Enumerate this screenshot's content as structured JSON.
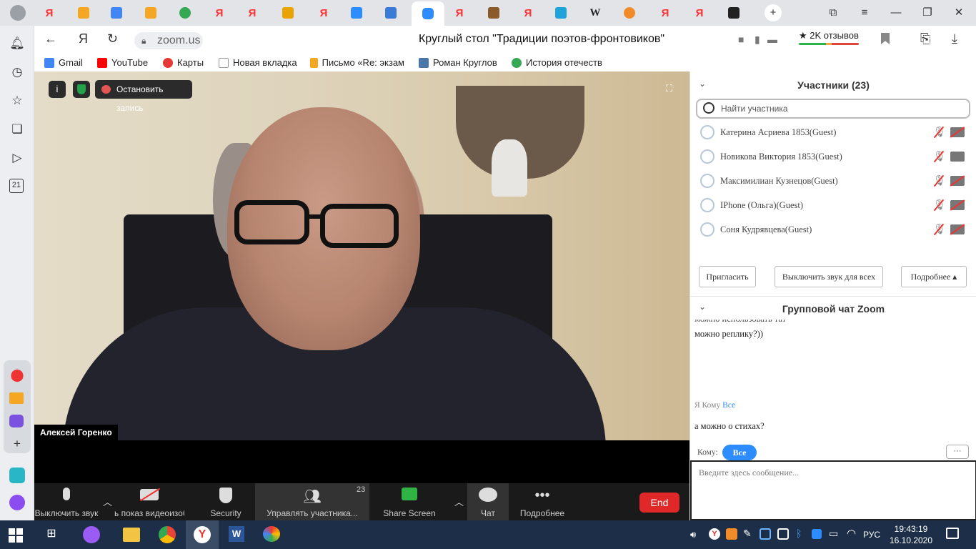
{
  "browser": {
    "url": "zoom.us",
    "page_title": "Круглый стол \"Традиции поэтов-фронтовиков\"",
    "reviews": "★ 2K отзывов"
  },
  "bookmarks": [
    {
      "label": "Gmail",
      "icon": "google-icon",
      "color": "#4285f4"
    },
    {
      "label": "YouTube",
      "icon": "youtube-icon",
      "color": "#ff0000"
    },
    {
      "label": "Карты",
      "icon": "maps-icon",
      "color": "#e53935"
    },
    {
      "label": "Новая вкладка",
      "icon": "page-icon",
      "color": "#999999"
    },
    {
      "label": "Письмо «Re: экзам",
      "icon": "mail-icon",
      "color": "#f5a623"
    },
    {
      "label": "Роман Круглов",
      "icon": "vk-icon",
      "color": "#4a76a8"
    },
    {
      "label": "История отечеств",
      "icon": "chrome-icon",
      "color": "#34a853"
    }
  ],
  "meeting": {
    "info_icon": "i",
    "record_label": "Остановить запись",
    "speaker_name": "Алексей Горенко"
  },
  "toolbar": {
    "mute": "Выключить звук",
    "video": "ь показ видеоизоб",
    "security": "Security",
    "manage": "Управлять участника...",
    "participants_count": "23",
    "share": "Share Screen",
    "chat": "Чат",
    "more": "Подробнее",
    "end": "End"
  },
  "participants": {
    "title": "Участники (23)",
    "search_placeholder": "Найти участника",
    "list": [
      {
        "name": "Катерина Асриева 1853(Guest)",
        "cam_off": true
      },
      {
        "name": "Новикова Виктория 1853(Guest)",
        "cam_off": false
      },
      {
        "name": "Максимилиан Кузнецов(Guest)",
        "cam_off": true
      },
      {
        "name": "IPhone (Ольга)(Guest)",
        "cam_off": true
      },
      {
        "name": "Соня Кудрявцева(Guest)",
        "cam_off": true
      }
    ],
    "invite": "Пригласить",
    "mute_all": "Выключить звук для всех",
    "more": "Подробнее ▴"
  },
  "chat": {
    "title": "Групповой чат Zoom",
    "cut_line": "можно использовать тат",
    "prev_message": "можно реплику?))",
    "from_me": "Я",
    "to_word": "Кому",
    "to_all": "Все",
    "message": "а можно о стихах?",
    "to_label": "Кому:",
    "recipient": "Все",
    "more_btn": "···",
    "input_placeholder": "Введите здесь сообщение..."
  },
  "taskbar": {
    "lang": "РУС",
    "time": "19:43:19",
    "date": "16.10.2020"
  },
  "colors": {
    "zoom_blue": "#2d8cff",
    "end_red": "#e02828",
    "yandex_red": "#ff3333",
    "taskbar": "#1d2f48"
  }
}
